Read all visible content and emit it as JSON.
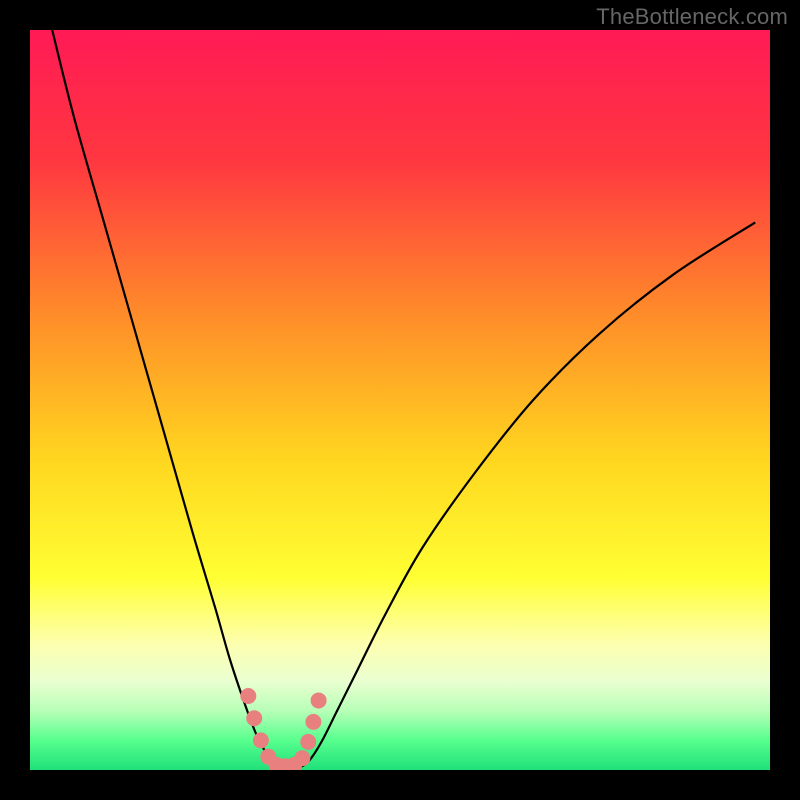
{
  "watermark": "TheBottleneck.com",
  "chart_data": {
    "type": "line",
    "title": "",
    "xlabel": "",
    "ylabel": "",
    "xlim": [
      0,
      100
    ],
    "ylim": [
      0,
      100
    ],
    "gradient_stops": [
      {
        "offset": 0,
        "color": "#ff1a55"
      },
      {
        "offset": 18,
        "color": "#ff3840"
      },
      {
        "offset": 38,
        "color": "#ff8a2a"
      },
      {
        "offset": 58,
        "color": "#ffd61f"
      },
      {
        "offset": 74,
        "color": "#ffff33"
      },
      {
        "offset": 83,
        "color": "#fdffb0"
      },
      {
        "offset": 88,
        "color": "#eaffd0"
      },
      {
        "offset": 92,
        "color": "#b7ffb7"
      },
      {
        "offset": 96,
        "color": "#57ff8e"
      },
      {
        "offset": 100,
        "color": "#1fe079"
      }
    ],
    "series": [
      {
        "name": "left-branch",
        "x": [
          3,
          6,
          10,
          14,
          18,
          22,
          25,
          27,
          29,
          30.5,
          31.5,
          32.3,
          33
        ],
        "y": [
          100,
          88,
          74,
          60,
          46,
          32,
          22,
          15,
          9,
          5,
          3,
          1.6,
          0.6
        ]
      },
      {
        "name": "right-branch",
        "x": [
          37,
          38,
          39.5,
          41.5,
          44,
          48,
          53,
          60,
          68,
          77,
          87,
          98
        ],
        "y": [
          0.6,
          1.6,
          4,
          8,
          13,
          21,
          30,
          40,
          50,
          59,
          67,
          74
        ]
      },
      {
        "name": "bottom-connector",
        "x": [
          33,
          34,
          35,
          36,
          37
        ],
        "y": [
          0.6,
          0.3,
          0.25,
          0.3,
          0.6
        ]
      }
    ],
    "markers": {
      "name": "dots",
      "color": "#e98080",
      "radius": 8,
      "points": [
        {
          "x": 29.5,
          "y": 10
        },
        {
          "x": 30.3,
          "y": 7
        },
        {
          "x": 31.2,
          "y": 4
        },
        {
          "x": 32.2,
          "y": 1.8
        },
        {
          "x": 33.3,
          "y": 0.7
        },
        {
          "x": 34.5,
          "y": 0.5
        },
        {
          "x": 35.7,
          "y": 0.7
        },
        {
          "x": 36.8,
          "y": 1.6
        },
        {
          "x": 37.6,
          "y": 3.8
        },
        {
          "x": 38.3,
          "y": 6.5
        },
        {
          "x": 39.0,
          "y": 9.4
        }
      ]
    }
  }
}
